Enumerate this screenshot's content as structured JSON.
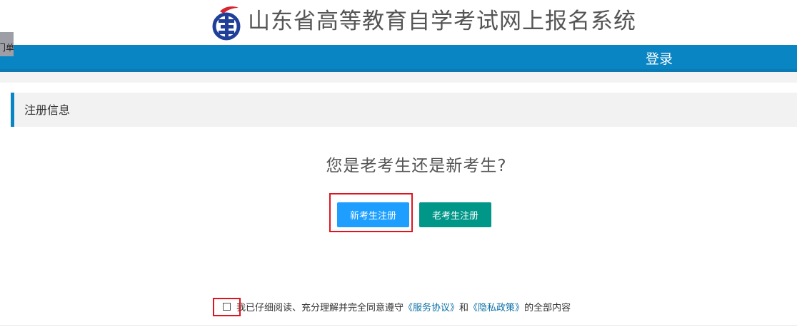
{
  "header": {
    "title": "山东省高等教育自学考试网上报名系统",
    "left_tab_label": "门单"
  },
  "nav": {
    "login_label": "登录"
  },
  "section": {
    "title": "注册信息"
  },
  "main": {
    "question": "您是老考生还是新考生?",
    "new_button_label": "新考生注册",
    "old_button_label": "老考生注册"
  },
  "agreement": {
    "text_prefix": "我已仔细阅读、充分理解并完全同意遵守",
    "service_link": "《服务协议》",
    "text_and": "和",
    "privacy_link": "《隐私政策》",
    "text_suffix": "的全部内容"
  },
  "colors": {
    "nav_blue": "#0a85c3",
    "new_button": "#1e9fff",
    "old_button": "#009688",
    "highlight_red": "#e0141e",
    "logo_red": "#d9232e",
    "logo_blue": "#1f3f98"
  },
  "icons": {
    "logo": "exam-logo-icon"
  }
}
